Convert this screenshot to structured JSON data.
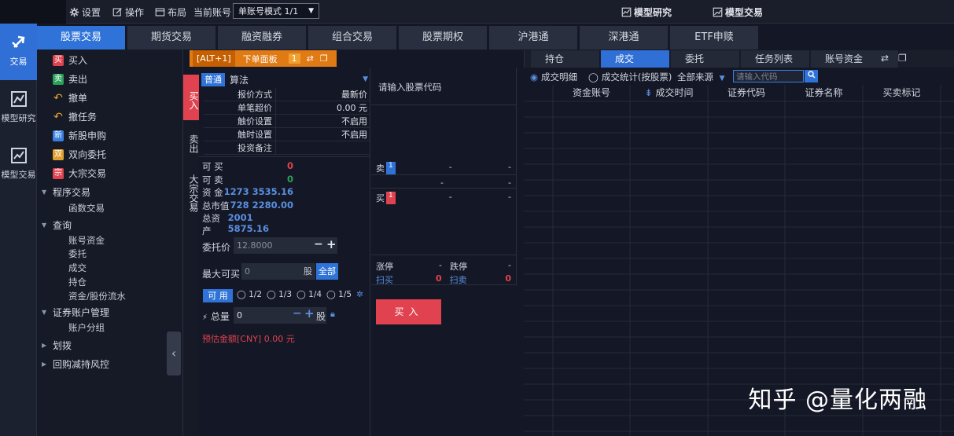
{
  "topbar": {
    "settings": "设置",
    "operate": "操作",
    "layout": "布局",
    "current_account_label": "当前账号",
    "account_mode": "单账号模式 1/1",
    "model_research": "模型研究",
    "model_trade": "模型交易"
  },
  "leftnav": {
    "trade": "交易",
    "research": "模型研究",
    "model_trade": "模型交易"
  },
  "tabs": [
    "股票交易",
    "期货交易",
    "融资融券",
    "组合交易",
    "股票期权",
    "沪港通",
    "深港通",
    "ETF申赎"
  ],
  "menu": {
    "items": [
      {
        "label": "买入",
        "badge": "买",
        "color": "#e0424f"
      },
      {
        "label": "卖出",
        "badge": "卖",
        "color": "#2aa05a"
      },
      {
        "label": "撤单",
        "badge": "",
        "color": "#e0a030"
      },
      {
        "label": "撤任务",
        "badge": "",
        "color": "#e0a030"
      },
      {
        "label": "新股申购",
        "badge": "新",
        "color": "#3a7fe0"
      },
      {
        "label": "双向委托",
        "badge": "双",
        "color": "#e0a030"
      },
      {
        "label": "大宗交易",
        "badge": "宗",
        "color": "#e0424f"
      }
    ],
    "program_trade": "程序交易",
    "func_trade": "函数交易",
    "query": "查询",
    "query_items": [
      "账号资金",
      "委托",
      "成交",
      "持仓",
      "资金/股份流水"
    ],
    "account_mgmt": "证券账户管理",
    "account_group": "账户分组",
    "transfer": "划拨",
    "repo_risk": "回购减持风控"
  },
  "vtabs": {
    "buy": "买入",
    "sell": "卖出",
    "block": "大宗交易"
  },
  "panel": {
    "hotkey": "[ALT+1]",
    "title": "下单面板",
    "index": "1"
  },
  "form": {
    "normal": "普通",
    "algo": "算法",
    "rows": [
      {
        "label": "报价方式",
        "value": "最新价"
      },
      {
        "label": "单笔超价",
        "value": "0.00 元"
      },
      {
        "label": "触价设置",
        "value": "不启用"
      },
      {
        "label": "触时设置",
        "value": "不启用"
      },
      {
        "label": "投资备注",
        "value": ""
      }
    ],
    "can_buy_label": "可 买",
    "can_buy": "0",
    "can_sell_label": "可 卖",
    "can_sell": "0",
    "funds_label": "资 金",
    "funds": "1273 3535.16",
    "market_value_label": "总市值",
    "market_value": "728 2280.00",
    "total_assets_label": "总资产",
    "total_assets": "2001 5875.16",
    "price_label": "委托价",
    "price": "12.8000",
    "max_buy_label": "最大可买",
    "max_buy": "0",
    "unit": "股",
    "all": "全部",
    "available": "可 用",
    "ratios": [
      "1/2",
      "1/3",
      "1/4",
      "1/5"
    ],
    "qty_label": "总量",
    "qty": "0",
    "estimate": "预估金额[CNY] 0.00 元"
  },
  "quote": {
    "prompt": "请输入股票代码",
    "sell_label": "卖",
    "sell_level": "1",
    "buy_label": "买",
    "buy_level": "1",
    "dash": "-",
    "limit_up": "涨停",
    "limit_down": "跌停",
    "sweep_buy": "扫买",
    "sweep_sell": "扫卖",
    "zero": "0"
  },
  "buy_button": "买入",
  "right": {
    "tabs": [
      "持仓",
      "成交",
      "委托",
      "任务列表",
      "账号资金"
    ],
    "filter_detail": "成交明细",
    "filter_stat": "成交统计(按股票)",
    "source": "全部来源",
    "code_placeholder": "请输入代码",
    "columns": [
      "资金账号",
      "成交时间",
      "证券代码",
      "证券名称",
      "买卖标记"
    ]
  },
  "watermark": "知乎 @量化两融"
}
